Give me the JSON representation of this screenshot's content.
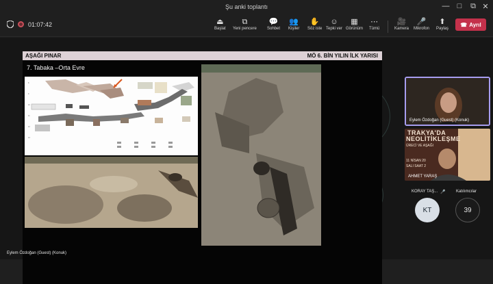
{
  "window": {
    "title": "Şu anki toplantı",
    "controls": [
      "—",
      "□",
      "⧉",
      "✕"
    ]
  },
  "meeting": {
    "timer": "01:07:42"
  },
  "toolbar": {
    "items": [
      {
        "label": "Başlat",
        "icon": "start-icon"
      },
      {
        "label": "Yeni pencere",
        "icon": "new-window-icon"
      },
      {
        "label": "Sohbet",
        "icon": "chat-icon"
      },
      {
        "label": "Kişiler",
        "icon": "people-icon"
      },
      {
        "label": "Söz iste",
        "icon": "raise-hand-icon"
      },
      {
        "label": "Tepki ver",
        "icon": "react-icon"
      },
      {
        "label": "Görünüm",
        "icon": "view-icon"
      },
      {
        "label": "Tümü",
        "icon": "more-icon"
      },
      {
        "label": "Kamera",
        "icon": "camera-icon"
      },
      {
        "label": "Mikrofon",
        "icon": "mic-icon"
      },
      {
        "label": "Paylaş",
        "icon": "share-icon"
      }
    ],
    "leave_label": "Ayrıl"
  },
  "slide": {
    "header_left": "AŞAĞI PINAR",
    "header_right": "MÖ 6. BİN YILIN İLK YARISI",
    "subtitle": "7. Tabaka –Orta Evre"
  },
  "participants": {
    "self_label": "Eylem Özdoğan (Guest) (Konuk)",
    "ahmet_label": "AHMET YARAŞ",
    "poster_line1": "TRAKYA'DA",
    "poster_line2": "NEOLİTİKLEŞME",
    "poster_line3": "ÜRECİ VE AŞAĞI",
    "poster_date": "11 NİSAN 20",
    "poster_time": "SALI SAAT 2",
    "koray_initials": "KT",
    "koray_label": "KORAY TAŞ...",
    "attendees_count": "39",
    "attendees_label": "Katılımcılar"
  },
  "presenter_label": "Eylem Özdoğan (Guest) (Konuk)",
  "colors": {
    "accent": "#a79df0",
    "leave": "#c4314b",
    "header": "#ddd1d6"
  }
}
